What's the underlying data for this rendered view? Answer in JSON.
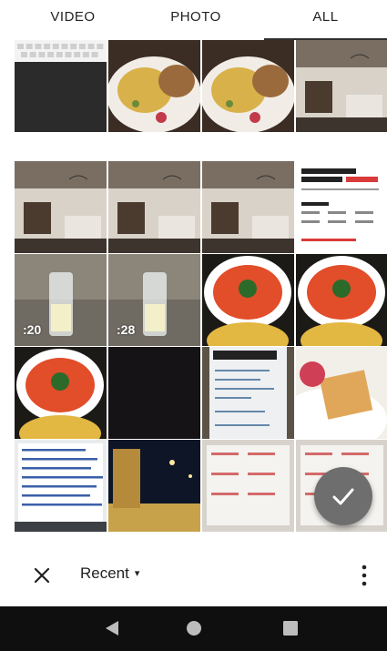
{
  "tabs": [
    {
      "label": "VIDEO",
      "active": false
    },
    {
      "label": "PHOTO",
      "active": false
    },
    {
      "label": "ALL",
      "active": true
    }
  ],
  "grid": {
    "tiles": [
      {
        "kind": "screenshot-keyboard"
      },
      {
        "kind": "breakfast-plate"
      },
      {
        "kind": "breakfast-plate"
      },
      {
        "kind": "cafe-interior"
      },
      {
        "kind": "cafe-interior"
      },
      {
        "kind": "cafe-interior"
      },
      {
        "kind": "cafe-interior"
      },
      {
        "kind": "document-reservation"
      },
      {
        "kind": "video-glass",
        "duration": ":20"
      },
      {
        "kind": "video-glass",
        "duration": ":28"
      },
      {
        "kind": "soup-bowl"
      },
      {
        "kind": "soup-bowl"
      },
      {
        "kind": "soup-bowl"
      },
      {
        "kind": "dark"
      },
      {
        "kind": "receipt"
      },
      {
        "kind": "waffle"
      },
      {
        "kind": "document-japanese"
      },
      {
        "kind": "night-street"
      },
      {
        "kind": "whiteboard"
      },
      {
        "kind": "whiteboard"
      }
    ]
  },
  "fab": {
    "icon": "check-icon"
  },
  "bottom_bar": {
    "close_icon": "close-icon",
    "album_label": "Recent",
    "caret": "▾",
    "more_icon": "more-vert-icon"
  },
  "nav": {
    "back_icon": "back-icon",
    "home_icon": "home-icon",
    "recents_icon": "recents-icon"
  },
  "colors": {
    "accent": "#6e6e6e",
    "navbar": "#0f0f0f"
  }
}
